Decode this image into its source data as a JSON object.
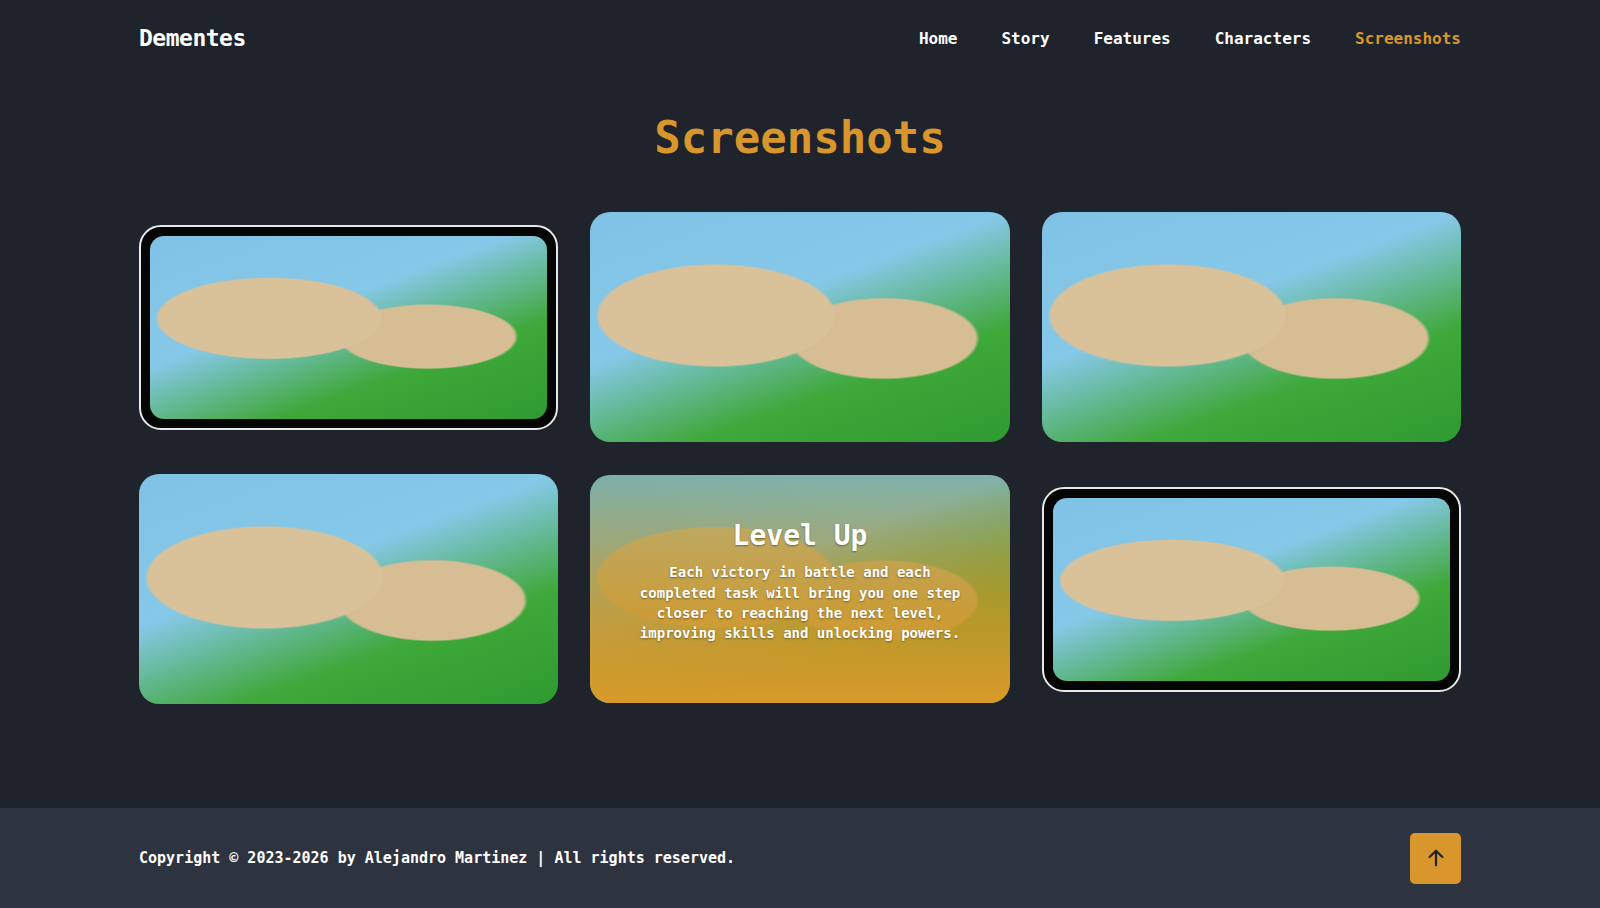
{
  "logo": "Dementes",
  "nav": [
    {
      "label": "Home",
      "selected": false
    },
    {
      "label": "Story",
      "selected": false
    },
    {
      "label": "Features",
      "selected": false
    },
    {
      "label": "Characters",
      "selected": false
    },
    {
      "label": "Screenshots",
      "selected": true
    }
  ],
  "heading": "Screenshots",
  "screenshots": [
    {
      "kind": "phone"
    },
    {
      "kind": "plain"
    },
    {
      "kind": "plain"
    },
    {
      "kind": "plain"
    },
    {
      "kind": "caption",
      "title": "Level Up",
      "text": "Each victory in battle and each completed task will bring you one step closer to reaching the next level, improving skills and unlocking powers."
    },
    {
      "kind": "phone"
    }
  ],
  "footer": {
    "copyright": "Copyright © 2023-2026 by Alejandro Martinez | All rights reserved."
  }
}
